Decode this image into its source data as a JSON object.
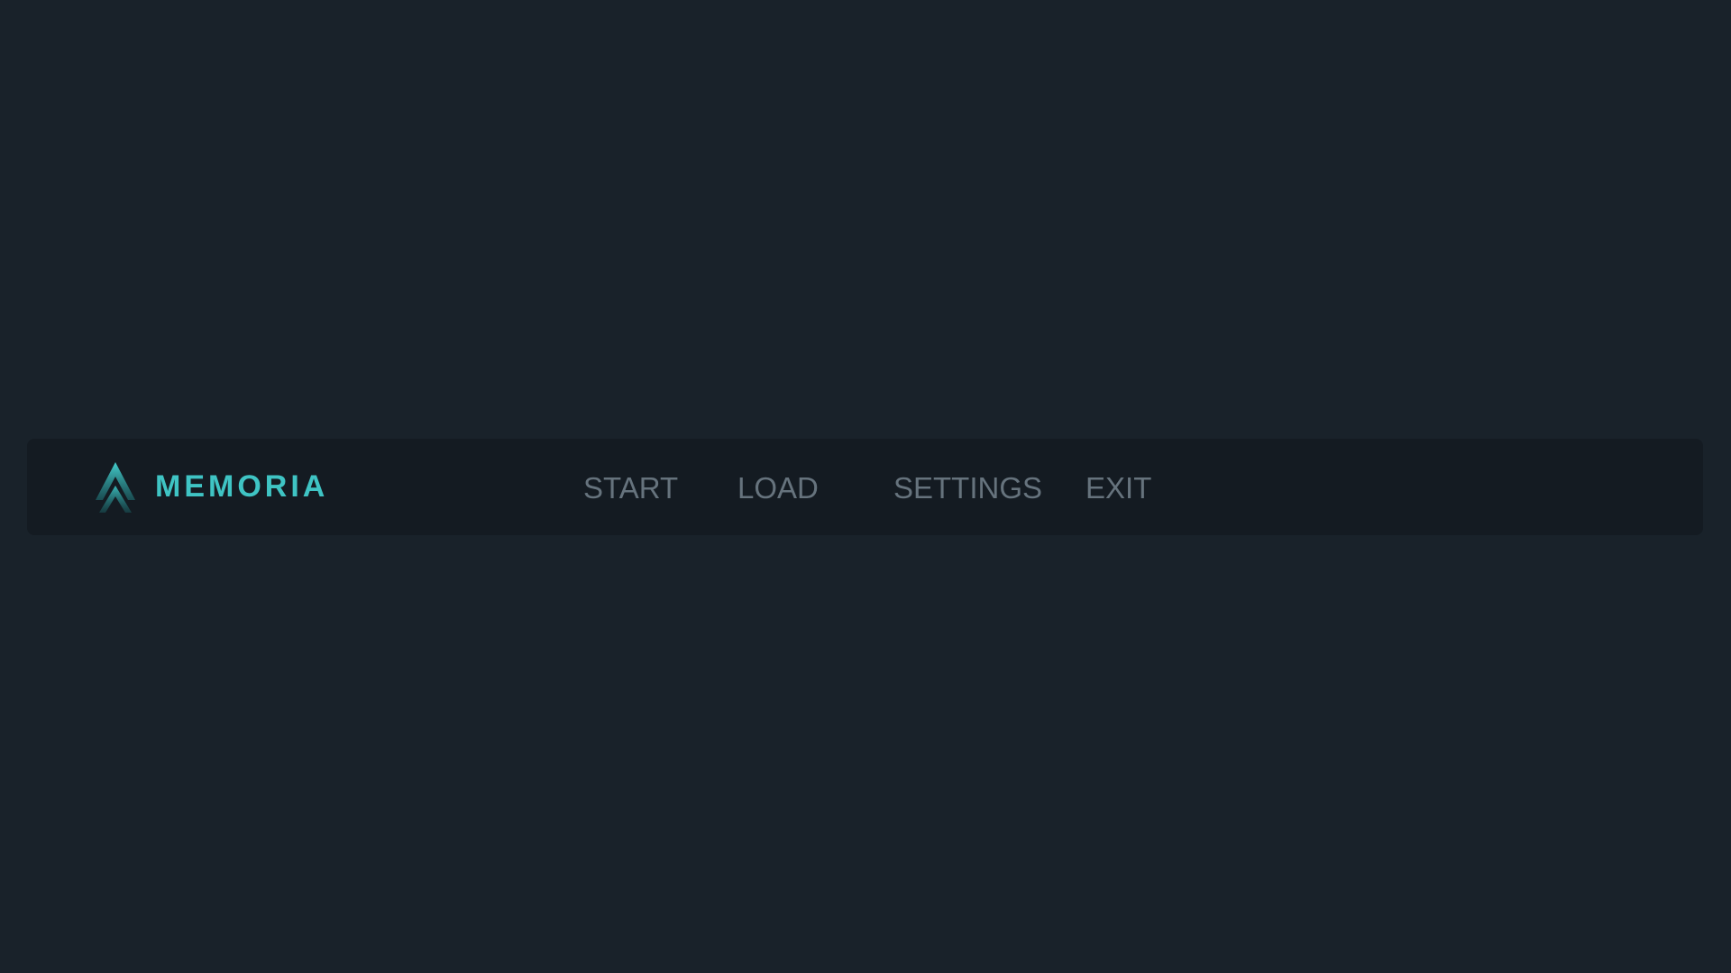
{
  "app": {
    "title": "MEMORIA",
    "logo_icon": "chevron-peak-icon"
  },
  "menu": {
    "items": [
      {
        "label": "START"
      },
      {
        "label": "LOAD"
      },
      {
        "label": "SETTINGS"
      },
      {
        "label": "EXIT"
      }
    ]
  },
  "colors": {
    "background": "#19222a",
    "bar": "#141b22",
    "accent": "#3fc4c4",
    "menu_text": "#66737d"
  }
}
